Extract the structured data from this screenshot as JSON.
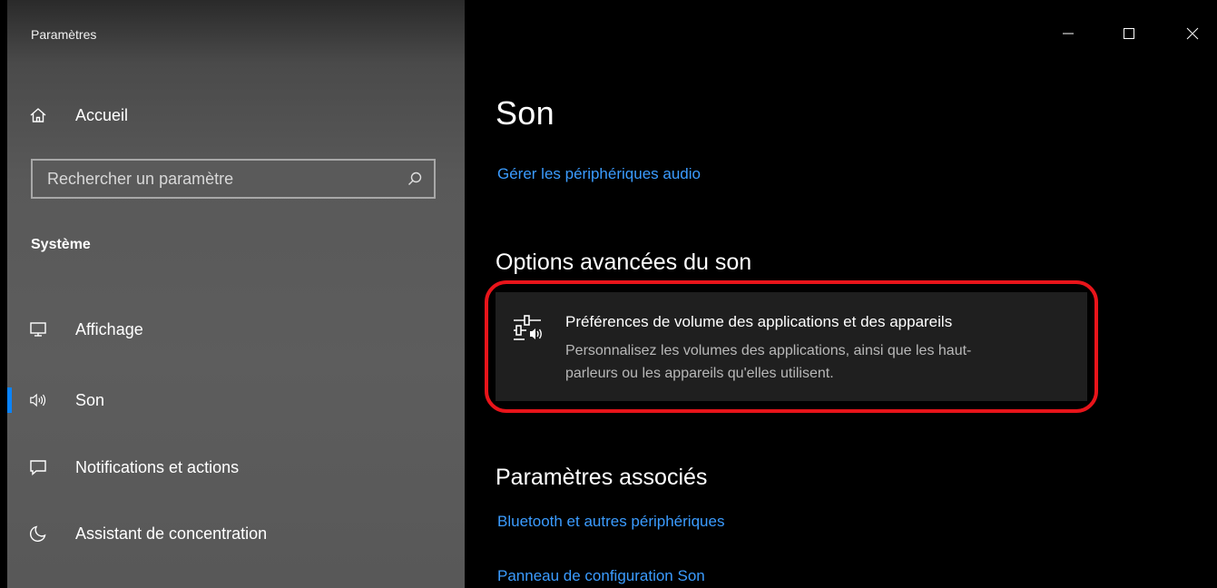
{
  "app": {
    "title": "Paramètres"
  },
  "window_controls": {
    "minimize_icon": "minimize-icon",
    "maximize_icon": "maximize-icon",
    "close_icon": "close-icon"
  },
  "sidebar": {
    "home_label": "Accueil",
    "home_icon": "home-icon",
    "search": {
      "placeholder": "Rechercher un paramètre",
      "value": "",
      "icon": "search-icon"
    },
    "section_heading": "Système",
    "items": [
      {
        "label": "Affichage",
        "icon": "monitor-icon",
        "active": false
      },
      {
        "label": "Son",
        "icon": "speaker-icon",
        "active": true
      },
      {
        "label": "Notifications et actions",
        "icon": "notification-icon",
        "active": false
      },
      {
        "label": "Assistant de concentration",
        "icon": "moon-icon",
        "active": false
      }
    ]
  },
  "main": {
    "page_title": "Son",
    "manage_devices_link": "Gérer les périphériques audio",
    "advanced_heading": "Options avancées du son",
    "preferences_card": {
      "title": "Préférences de volume des applications et des appareils",
      "description_line1": "Personnalisez les volumes des applications, ainsi que les haut-",
      "description_line2": "parleurs ou les appareils qu'elles utilisent.",
      "icon": "volume-mixer-icon",
      "highlighted": true
    },
    "related_heading": "Paramètres associés",
    "related_links": [
      "Bluetooth et autres périphériques",
      "Panneau de configuration Son"
    ]
  },
  "colors": {
    "accent": "#0a84ff",
    "link": "#3b9cff",
    "highlight": "#e8141a",
    "card_background": "#1f1f1f"
  }
}
